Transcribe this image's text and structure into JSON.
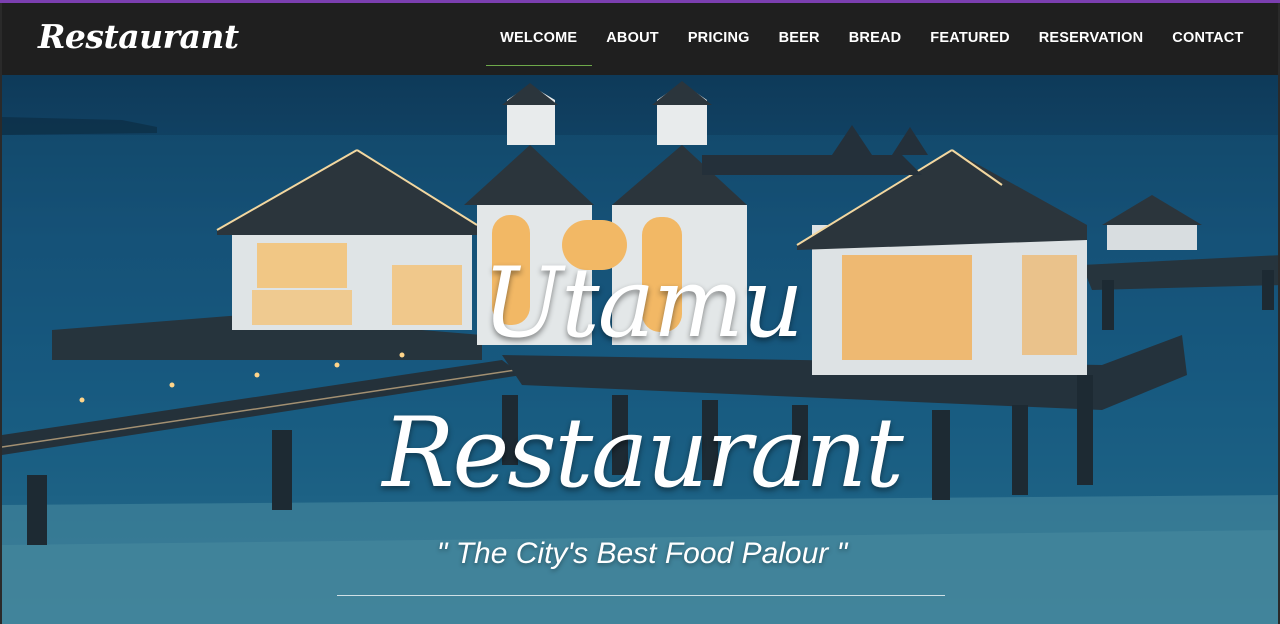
{
  "brand": {
    "name": "Restaurant"
  },
  "nav": {
    "items": [
      {
        "label": "WELCOME",
        "active": true
      },
      {
        "label": "ABOUT"
      },
      {
        "label": "PRICING"
      },
      {
        "label": "BEER"
      },
      {
        "label": "BREAD"
      },
      {
        "label": "FEATURED"
      },
      {
        "label": "RESERVATION"
      },
      {
        "label": "CONTACT"
      }
    ]
  },
  "hero": {
    "title_line1": "Utamu",
    "title_line2": "Restaurant",
    "tagline": "\" The City's Best Food Palour \"",
    "image": "pier-restaurant-at-dusk"
  },
  "colors": {
    "accent_top": "#7b3fb0",
    "active_underline": "#6ea94a",
    "navbar_bg": "#1f1f1f"
  }
}
